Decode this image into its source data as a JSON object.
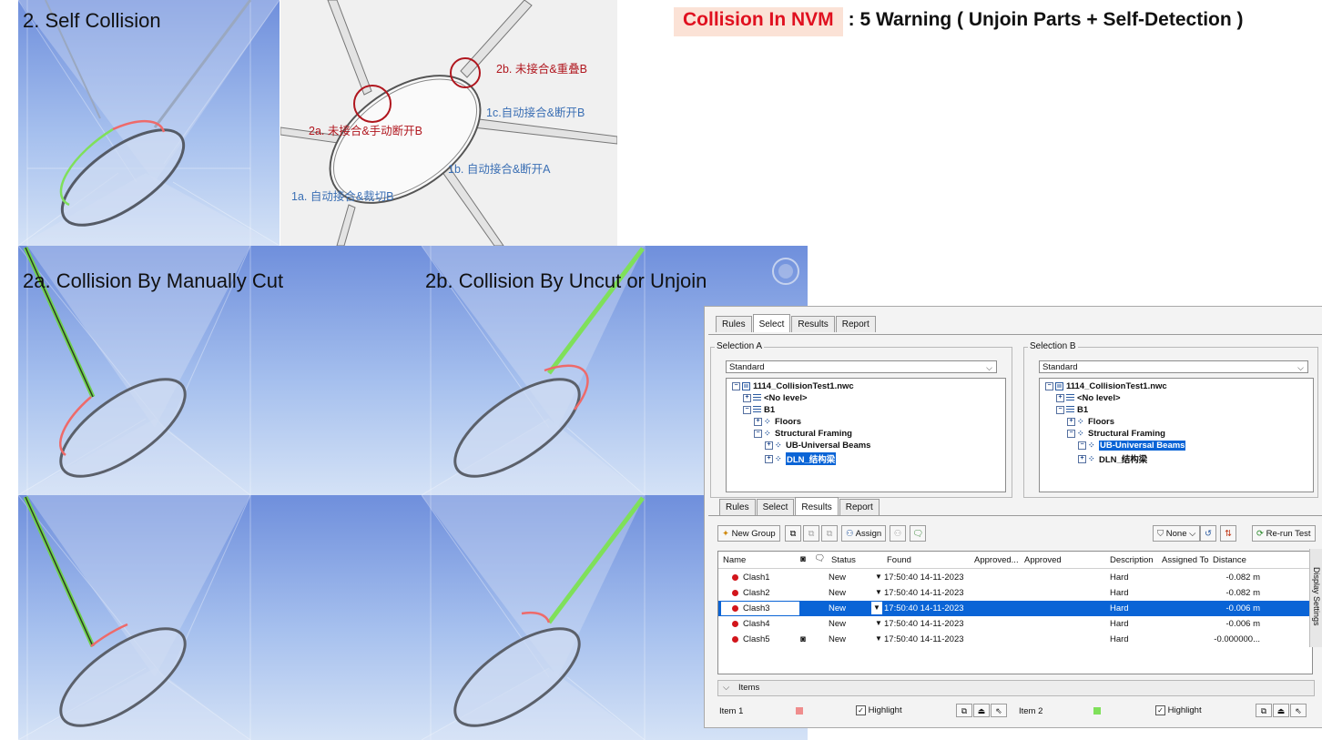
{
  "title": {
    "highlight": "Collision In NVM",
    "rest": ": 5 Warning ( Unjoin Parts + Self-Detection )"
  },
  "captions": {
    "self_collision": "2. Self Collision",
    "manual_cut": "2a. Collision By Manually Cut",
    "uncut": "2b. Collision By Uncut or Unjoin"
  },
  "diagram": {
    "labels": {
      "a2": "2a. 未接合&手动断开B",
      "b2": "2b. 未接合&重叠B",
      "c1": "1c.自动接合&断开B",
      "b1": "1b. 自动接合&断开A",
      "a1": "1a. 自动接合&裁切B"
    }
  },
  "colors": {
    "title_red": "#e0101f",
    "highlight_green": "#7fe05a",
    "clash_red": "#d2151b",
    "selection_blue": "#0a64d6"
  },
  "panel": {
    "top_tabs": [
      "Rules",
      "Select",
      "Results",
      "Report"
    ],
    "top_active_tab": "Select",
    "selection_a": {
      "title": "Selection A",
      "combo": "Standard",
      "tree": [
        "1114_CollisionTest1.nwc",
        "<No level>",
        "B1",
        "Floors",
        "Structural Framing",
        "UB-Universal Beams",
        "DLN_结构梁"
      ]
    },
    "selection_b": {
      "title": "Selection B",
      "combo": "Standard",
      "tree": [
        "1114_CollisionTest1.nwc",
        "<No level>",
        "B1",
        "Floors",
        "Structural Framing",
        "UB-Universal Beams",
        "DLN_结构梁"
      ]
    },
    "bottom_tabs": [
      "Rules",
      "Select",
      "Results",
      "Report"
    ],
    "bottom_active_tab": "Results",
    "toolbar": {
      "new_group": "New Group",
      "assign": "Assign",
      "none": "None",
      "rerun": "Re-run Test"
    },
    "columns": [
      "Name",
      "Status",
      "Found",
      "Approved...",
      "Approved",
      "Description",
      "Assigned To",
      "Distance"
    ],
    "rows": [
      {
        "name": "Clash1",
        "status": "New",
        "found": "17:50:40 14-11-2023",
        "description": "Hard",
        "distance": "-0.082 m"
      },
      {
        "name": "Clash2",
        "status": "New",
        "found": "17:50:40 14-11-2023",
        "description": "Hard",
        "distance": "-0.082 m"
      },
      {
        "name": "Clash3",
        "status": "New",
        "found": "17:50:40 14-11-2023",
        "description": "Hard",
        "distance": "-0.006 m"
      },
      {
        "name": "Clash4",
        "status": "New",
        "found": "17:50:40 14-11-2023",
        "description": "Hard",
        "distance": "-0.006 m"
      },
      {
        "name": "Clash5",
        "status": "New",
        "found": "17:50:40 14-11-2023",
        "description": "Hard",
        "distance": "-0.000000..."
      }
    ],
    "selected_row": "Clash3",
    "side_tab": "Display Settings",
    "items": {
      "header": "Items",
      "item1": "Item 1",
      "item2": "Item 2",
      "highlight": "Highlight"
    }
  }
}
